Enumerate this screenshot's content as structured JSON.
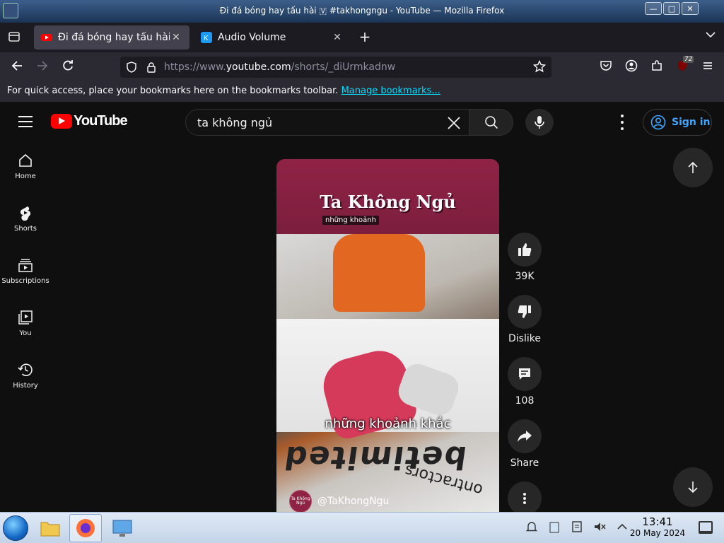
{
  "window": {
    "title": "Đi đá bóng hay tấu hài 🇻 #takhongngu - YouTube — Mozilla Firefox",
    "buttons": [
      "minimize",
      "maximize",
      "close"
    ]
  },
  "tabs": [
    {
      "label": "Đi đá bóng hay tấu hài 🇻",
      "favicon": "youtube-icon",
      "active": true
    },
    {
      "label": "Audio Volume",
      "favicon": "kde-icon",
      "active": false
    }
  ],
  "nav": {
    "url_prefix": "https://www.",
    "url_domain": "youtube.com",
    "url_path": "/shorts/_diUrmkadnw",
    "extension_badge": "72"
  },
  "bookmarks_bar": {
    "text": "For quick access, place your bookmarks here on the bookmarks toolbar.",
    "link": "Manage bookmarks..."
  },
  "youtube": {
    "logo_text": "YouTube",
    "search_value": "ta không ngủ",
    "sign_in": "Sign in",
    "guide": [
      {
        "label": "Home",
        "icon": "home-icon"
      },
      {
        "label": "Shorts",
        "icon": "shorts-icon"
      },
      {
        "label": "Subscriptions",
        "icon": "subscriptions-icon"
      },
      {
        "label": "You",
        "icon": "you-icon"
      },
      {
        "label": "History",
        "icon": "history-icon"
      }
    ],
    "short": {
      "overlay_title": "Ta Không Ngủ",
      "overlay_subtitle": "những khoảnh",
      "caption": "những khoảnh khắc",
      "channel": "@TaKhongNgu",
      "channel_avatar_text": "Ta Không Ngủ",
      "scene_text_1": "betimited",
      "scene_text_2": "ontractors"
    },
    "actions": {
      "likes": "39K",
      "dislike": "Dislike",
      "comments": "108",
      "share": "Share"
    }
  },
  "taskbar": {
    "time": "13:41",
    "date": "20 May 2024"
  },
  "colors": {
    "youtube_red": "#ff0000",
    "signin_blue": "#3ea6ff",
    "banner": "#8f2346"
  }
}
